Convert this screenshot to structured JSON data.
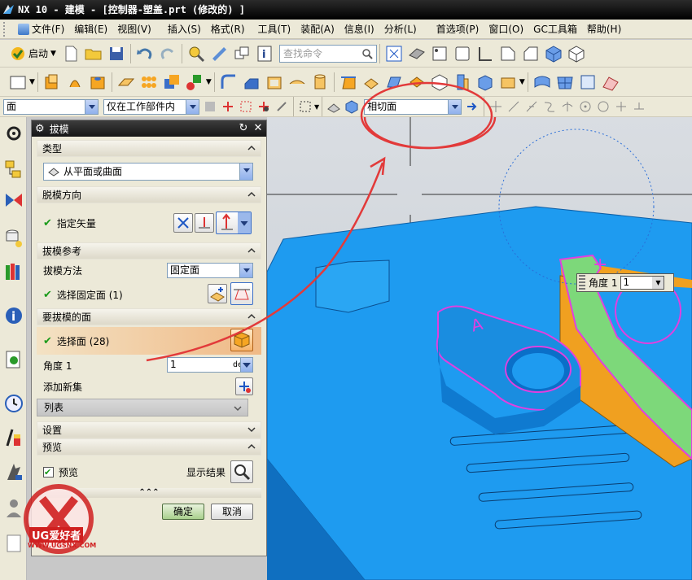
{
  "title": {
    "text": "NX 10 - 建模 - [控制器-塑盖.prt  (修改的) ]"
  },
  "menu": {
    "items": [
      {
        "label": "文件(F)"
      },
      {
        "label": "编辑(E)"
      },
      {
        "label": "视图(V)"
      },
      {
        "label": "插入(S)"
      },
      {
        "label": "格式(R)"
      },
      {
        "label": "工具(T)"
      },
      {
        "label": "装配(A)"
      },
      {
        "label": "信息(I)"
      },
      {
        "label": "分析(L)"
      },
      {
        "label": "首选项(P)"
      },
      {
        "label": "窗口(O)"
      },
      {
        "label": "GC工具箱"
      },
      {
        "label": "帮助(H)"
      }
    ]
  },
  "toolbar": {
    "start_label": "启动",
    "search_placeholder": "查找命令"
  },
  "selection_bar": {
    "filter_value": "面",
    "scope_value": "仅在工作部件内",
    "face_rule_value": "相切面"
  },
  "dialog": {
    "title": "拔模",
    "sections": {
      "type": "类型",
      "draft_direction": "脱模方向",
      "draft_reference": "拔模参考",
      "faces_to_draft": "要拔模的面",
      "settings": "设置",
      "preview": "预览"
    },
    "type_value": "从平面或曲面",
    "specify_vector": "指定矢量",
    "draft_method_label": "拔模方法",
    "draft_method_value": "固定面",
    "select_stationary_face": "选择固定面 (1)",
    "select_face": "选择面 (28)",
    "angle_label": "角度 1",
    "angle_value": "1",
    "angle_unit": "deg",
    "add_new_set": "添加新集",
    "list_label": "列表",
    "preview_checkbox": "预览",
    "show_result": "显示结果",
    "ok": "确定",
    "cancel": "取消"
  },
  "viewport": {
    "angle_label": "角度 1",
    "angle_value": "1",
    "label_a": "A"
  },
  "watermark": {
    "brand": "UG爱好者",
    "url": "WWW.UGSNX.COM"
  },
  "colors": {
    "part_blue": "#1e9bf0",
    "highlight_orange": "#f0a020",
    "face_green": "#7dd87a",
    "annotation_red": "#e23a3a"
  }
}
